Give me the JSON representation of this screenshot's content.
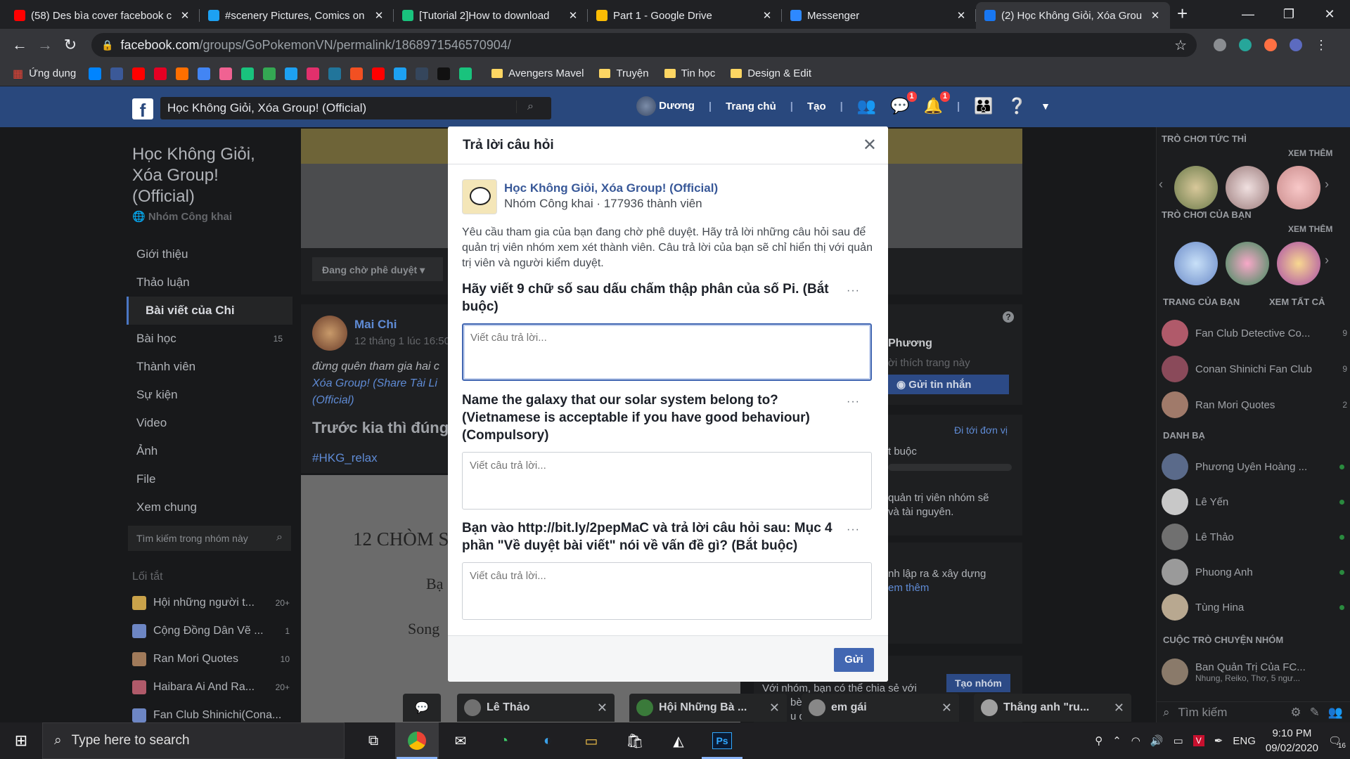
{
  "browser": {
    "tabs": [
      {
        "title": "(58) Des bìa cover facebook c",
        "color": "#ff0000",
        "active": false
      },
      {
        "title": "#scenery Pictures, Comics on",
        "color": "#1da1f2",
        "active": false
      },
      {
        "title": "[Tutorial 2]How to download",
        "color": "#19c37d",
        "active": false
      },
      {
        "title": "Part 1 - Google Drive",
        "color": "#fbbc04",
        "active": false
      },
      {
        "title": "Messenger",
        "color": "#2e89ff",
        "active": false
      },
      {
        "title": "(2) Học Không Giỏi, Xóa Grou",
        "color": "#1877f2",
        "active": true
      }
    ],
    "new_tab": "+",
    "window_controls": [
      "—",
      "❐",
      "✕"
    ],
    "url_host": "facebook.com",
    "url_path": "/groups/GoPokemonVN/permalink/1868971546570904/",
    "bookmarks": {
      "apps_label": "Ứng dụng",
      "icons": [
        "#0084ff",
        "#3b5998",
        "#ff0000",
        "#e60023",
        "#ff6f00",
        "#4285f4",
        "#f06292",
        "#19c37d",
        "#34a853",
        "#1da1f2",
        "#e1306c",
        "#21759b",
        "#f25022",
        "#ff0000",
        "#1da1f2",
        "#35465c",
        "#111111",
        "#19c37d"
      ],
      "folders": [
        "Avengers Mavel",
        "Truyện",
        "Tin học",
        "Design & Edit"
      ]
    }
  },
  "fb": {
    "search_value": "Học Không Giỏi, Xóa Group! (Official)",
    "nav_user": "Dương",
    "nav_home": "Trang chủ",
    "nav_create": "Tạo",
    "badge_messages": "1",
    "badge_notifications": "1"
  },
  "left": {
    "group_title": "Học Không Giỏi, Xóa Group! (Official)",
    "group_type": "Nhóm Công khai",
    "nav": [
      {
        "label": "Giới thiệu",
        "count": ""
      },
      {
        "label": "Thảo luận",
        "count": ""
      },
      {
        "label": "Bài viết của Chi",
        "count": ""
      },
      {
        "label": "Bài học",
        "count": "15"
      },
      {
        "label": "Thành viên",
        "count": ""
      },
      {
        "label": "Sự kiện",
        "count": ""
      },
      {
        "label": "Video",
        "count": ""
      },
      {
        "label": "Ảnh",
        "count": ""
      },
      {
        "label": "File",
        "count": ""
      },
      {
        "label": "Xem chung",
        "count": ""
      }
    ],
    "search_placeholder": "Tìm kiếm trong nhóm này",
    "shortcuts_heading": "Lối tắt",
    "shortcuts": [
      {
        "name": "Hội những người t...",
        "count": "20+",
        "color": "#c9a24a"
      },
      {
        "name": "Cộng Đồng Dân Vẽ ...",
        "count": "1",
        "color": "#6d86c4"
      },
      {
        "name": "Ran Mori Quotes",
        "count": "10",
        "color": "#a07a5a"
      },
      {
        "name": "Haibara Ai And Ra...",
        "count": "20+",
        "color": "#b05a6a"
      },
      {
        "name": "Fan Club Shinichi(Cona...",
        "count": "",
        "color": "#6d86c4"
      }
    ]
  },
  "center": {
    "pending_label": "Đang chờ phê duyệt",
    "post_author": "Mai Chi",
    "post_time": "12 tháng 1 lúc 16:50",
    "post_text_1": "đừng quên tham gia hai c",
    "post_text_link": "Xóa Group! (Share Tài Li",
    "post_text_link2": "(Official)",
    "post_big": "Trước kia thì đúng",
    "post_tag": "#HKG_relax",
    "image_t1": "12 CHÒM S",
    "image_t2": "Bạ",
    "image_t3": "Song",
    "right_card1_name": "Phương",
    "right_card1_sub": "ời thích trang này",
    "right_card1_btn": "Gửi tin nhắn",
    "right_card2_link": "Đi tới đơn vị",
    "right_card2_a": "t buộc",
    "right_card2_b": "quản trị viên nhóm sẽ",
    "right_card2_c": "và tài nguyên.",
    "right_card3_a": "nh lập ra & xây dựng",
    "right_card3_b": "em thêm",
    "right_card4_a": "Với nhóm, bạn có thể chia sẻ với",
    "right_card4_b": "bè,",
    "right_card4_c": "u đã",
    "right_card4_btn": "Tạo nhóm"
  },
  "modal": {
    "title": "Trả lời câu hỏi",
    "group_name": "Học Không Giỏi, Xóa Group! (Official)",
    "group_meta": "Nhóm Công khai · 177936 thành viên",
    "description": "Yêu cầu tham gia của bạn đang chờ phê duyệt. Hãy trả lời những câu hỏi sau để quản trị viên nhóm xem xét thành viên. Câu trả lời của bạn sẽ chỉ hiển thị với quản trị viên và người kiểm duyệt.",
    "questions": [
      {
        "label": "Hãy viết 9 chữ số sau dấu chấm thập phân của số Pi. (Bắt buộc)",
        "placeholder": "Viết câu trả lời...",
        "value": ""
      },
      {
        "label": "Name the galaxy that our solar system belong to? (Vietnamese is acceptable if you have good behaviour) (Compulsory)",
        "placeholder": "Viết câu trả lời...",
        "value": ""
      },
      {
        "label": "Bạn vào http://bit.ly/2pepMaC và trả lời câu hỏi sau: Mục 4 phần \"Về duyệt bài viết\" nói về vấn đề gì? (Bắt buộc)",
        "placeholder": "Viết câu trả lời...",
        "value": ""
      }
    ],
    "more": "···",
    "send": "Gửi"
  },
  "right": {
    "instant_games": "TRÒ CHƠI TỨC THÌ",
    "see_more": "XEM THÊM",
    "your_games": "TRÒ CHƠI CỦA BẠN",
    "your_pages": "TRANG CỦA BẠN",
    "see_all": "XEM TẤT CẢ",
    "pages": [
      {
        "name": "Fan Club Detective Co...",
        "count": "9",
        "color": "#b05a6a"
      },
      {
        "name": "Conan Shinichi Fan Club",
        "count": "9",
        "color": "#8a4a5a"
      },
      {
        "name": "Ran Mori Quotes",
        "count": "2",
        "color": "#a07a6a"
      }
    ],
    "contacts_heading": "DANH BẠ",
    "contacts": [
      {
        "name": "Phương Uyên Hoàng ...",
        "color": "#5a6a8a"
      },
      {
        "name": "Lê Yến",
        "color": "#c8c8c8"
      },
      {
        "name": "Lê Thảo",
        "color": "#707070"
      },
      {
        "name": "Phuong Anh",
        "color": "#9a9a9a"
      },
      {
        "name": "Tùng Hina",
        "color": "#b8a890"
      }
    ],
    "group_chats_heading": "CUỘC TRÒ CHUYỆN NHÓM",
    "group_chat_name": "Ban Quản Trị Của FC...",
    "group_chat_members": "Nhung, Reiko, Thơ, 5 ngư...",
    "search_placeholder": "Tìm kiếm"
  },
  "chats": [
    {
      "name": "Lê Thảo",
      "color": "#707070"
    },
    {
      "name": "Hội Những Bà ...",
      "color": "#3a7a3a"
    },
    {
      "name": "em gái",
      "color": "#888888"
    },
    {
      "name": "Thằng anh \"ru...",
      "color": "#a0a0a0"
    }
  ],
  "taskbar": {
    "search_placeholder": "Type here to search",
    "lang": "ENG",
    "time": "9:10 PM",
    "date": "09/02/2020",
    "notif_count": "16"
  }
}
